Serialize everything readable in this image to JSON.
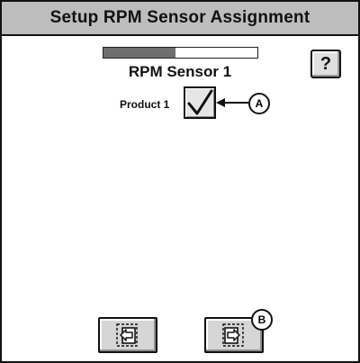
{
  "window": {
    "title": "Setup RPM Sensor Assignment"
  },
  "progress": {
    "fraction": 0.47
  },
  "sensor": {
    "title": "RPM Sensor 1"
  },
  "help": {
    "label": "?"
  },
  "assignment": {
    "product_label": "Product 1",
    "checked": true
  },
  "callouts": {
    "a": "A",
    "b": "B"
  },
  "icons": {
    "help": "question-mark-icon",
    "check": "checkmark-icon",
    "back": "back-arrow-icon",
    "next": "next-arrow-icon"
  }
}
